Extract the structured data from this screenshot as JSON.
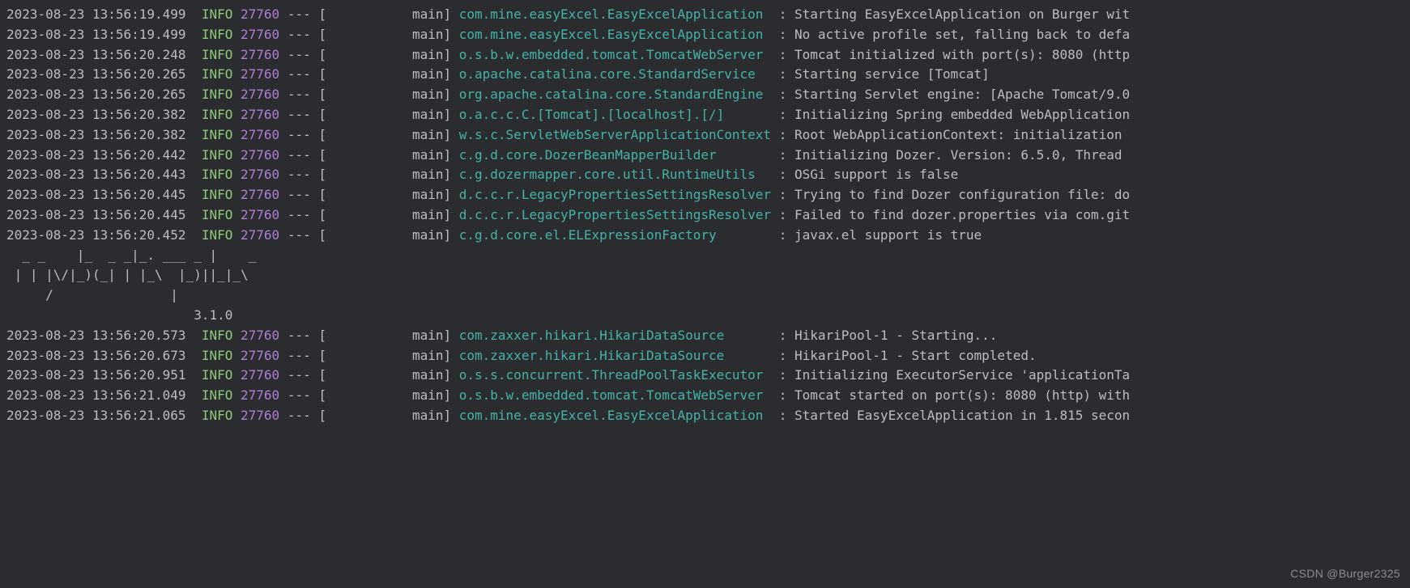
{
  "colors": {
    "background": "#2a2c2f",
    "text": "#bdbdbd",
    "level_info": "#8fc97a",
    "pid": "#b07fd4",
    "logger": "#45b3a8"
  },
  "watermark": "CSDN @Burger2325",
  "ascii_art": [
    "  _ _    |_  _ _|_. ___ _ |    _ ",
    " | | |\\/|_)(_| | |_\\  |_)||_|_\\ ",
    "     /               |         ",
    "                        3.1.0 "
  ],
  "logs": [
    {
      "timestamp": "2023-08-23 13:56:19.499",
      "level": "INFO",
      "pid": "27760",
      "dash": "---",
      "thread": "main",
      "logger": "com.mine.easyExcel.EasyExcelApplication",
      "message": "Starting EasyExcelApplication on Burger wit"
    },
    {
      "timestamp": "2023-08-23 13:56:19.499",
      "level": "INFO",
      "pid": "27760",
      "dash": "---",
      "thread": "main",
      "logger": "com.mine.easyExcel.EasyExcelApplication",
      "message": "No active profile set, falling back to defa"
    },
    {
      "timestamp": "2023-08-23 13:56:20.248",
      "level": "INFO",
      "pid": "27760",
      "dash": "---",
      "thread": "main",
      "logger": "o.s.b.w.embedded.tomcat.TomcatWebServer",
      "message": "Tomcat initialized with port(s): 8080 (http"
    },
    {
      "timestamp": "2023-08-23 13:56:20.265",
      "level": "INFO",
      "pid": "27760",
      "dash": "---",
      "thread": "main",
      "logger": "o.apache.catalina.core.StandardService",
      "message": "Starting service [Tomcat]"
    },
    {
      "timestamp": "2023-08-23 13:56:20.265",
      "level": "INFO",
      "pid": "27760",
      "dash": "---",
      "thread": "main",
      "logger": "org.apache.catalina.core.StandardEngine",
      "message": "Starting Servlet engine: [Apache Tomcat/9.0"
    },
    {
      "timestamp": "2023-08-23 13:56:20.382",
      "level": "INFO",
      "pid": "27760",
      "dash": "---",
      "thread": "main",
      "logger": "o.a.c.c.C.[Tomcat].[localhost].[/]",
      "message": "Initializing Spring embedded WebApplication"
    },
    {
      "timestamp": "2023-08-23 13:56:20.382",
      "level": "INFO",
      "pid": "27760",
      "dash": "---",
      "thread": "main",
      "logger": "w.s.c.ServletWebServerApplicationContext",
      "message": "Root WebApplicationContext: initialization "
    },
    {
      "timestamp": "2023-08-23 13:56:20.442",
      "level": "INFO",
      "pid": "27760",
      "dash": "---",
      "thread": "main",
      "logger": "c.g.d.core.DozerBeanMapperBuilder",
      "message": "Initializing Dozer. Version: 6.5.0, Thread "
    },
    {
      "timestamp": "2023-08-23 13:56:20.443",
      "level": "INFO",
      "pid": "27760",
      "dash": "---",
      "thread": "main",
      "logger": "c.g.dozermapper.core.util.RuntimeUtils",
      "message": "OSGi support is false"
    },
    {
      "timestamp": "2023-08-23 13:56:20.445",
      "level": "INFO",
      "pid": "27760",
      "dash": "---",
      "thread": "main",
      "logger": "d.c.c.r.LegacyPropertiesSettingsResolver",
      "message": "Trying to find Dozer configuration file: do"
    },
    {
      "timestamp": "2023-08-23 13:56:20.445",
      "level": "INFO",
      "pid": "27760",
      "dash": "---",
      "thread": "main",
      "logger": "d.c.c.r.LegacyPropertiesSettingsResolver",
      "message": "Failed to find dozer.properties via com.git"
    },
    {
      "timestamp": "2023-08-23 13:56:20.452",
      "level": "INFO",
      "pid": "27760",
      "dash": "---",
      "thread": "main",
      "logger": "c.g.d.core.el.ELExpressionFactory",
      "message": "javax.el support is true"
    }
  ],
  "logs_after": [
    {
      "timestamp": "2023-08-23 13:56:20.573",
      "level": "INFO",
      "pid": "27760",
      "dash": "---",
      "thread": "main",
      "logger": "com.zaxxer.hikari.HikariDataSource",
      "message": "HikariPool-1 - Starting..."
    },
    {
      "timestamp": "2023-08-23 13:56:20.673",
      "level": "INFO",
      "pid": "27760",
      "dash": "---",
      "thread": "main",
      "logger": "com.zaxxer.hikari.HikariDataSource",
      "message": "HikariPool-1 - Start completed."
    },
    {
      "timestamp": "2023-08-23 13:56:20.951",
      "level": "INFO",
      "pid": "27760",
      "dash": "---",
      "thread": "main",
      "logger": "o.s.s.concurrent.ThreadPoolTaskExecutor",
      "message": "Initializing ExecutorService 'applicationTa"
    },
    {
      "timestamp": "2023-08-23 13:56:21.049",
      "level": "INFO",
      "pid": "27760",
      "dash": "---",
      "thread": "main",
      "logger": "o.s.b.w.embedded.tomcat.TomcatWebServer",
      "message": "Tomcat started on port(s): 8080 (http) with"
    },
    {
      "timestamp": "2023-08-23 13:56:21.065",
      "level": "INFO",
      "pid": "27760",
      "dash": "---",
      "thread": "main",
      "logger": "com.mine.easyExcel.EasyExcelApplication",
      "message": "Started EasyExcelApplication in 1.815 secon"
    }
  ]
}
